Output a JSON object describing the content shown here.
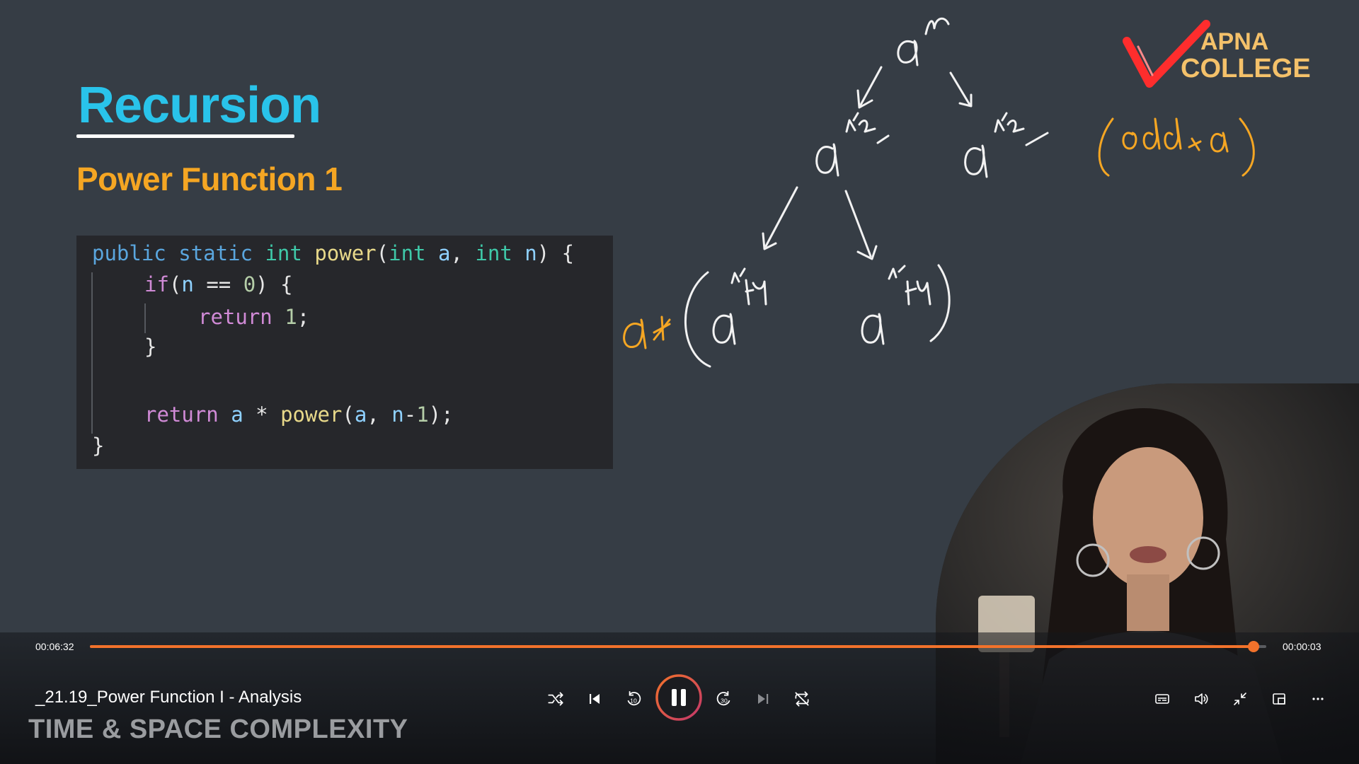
{
  "slide": {
    "title": "Recursion",
    "subtitle": "Power Function 1",
    "code": {
      "l1_public": "public",
      "l1_static": "static",
      "l1_int": "int",
      "l1_fn": "power",
      "l1_int2": "int",
      "l1_a": "a",
      "l1_int3": "int",
      "l1_n": "n",
      "l2_if": "if",
      "l2_n": "n",
      "l2_zero": "0",
      "l3_return": "return",
      "l3_one": "1",
      "l5_return": "return",
      "l5_a": "a",
      "l5_fn": "power",
      "l5_a2": "a",
      "l5_n": "n",
      "l5_one": "1"
    }
  },
  "logo": {
    "line1": "APNA",
    "line2": "COLLEGE"
  },
  "player": {
    "elapsed": "00:06:32",
    "remaining": "00:00:03",
    "progress": 0.989,
    "media_title": "_21.19_Power Function I - Analysis",
    "overlay_title": "TIME & SPACE COMPLEXITY",
    "accent_color": "#f2722b"
  },
  "icons": {
    "shuffle": "shuffle-icon",
    "previous": "previous-icon",
    "rewind": "rewind-10-icon",
    "pause": "pause-icon",
    "forward": "forward-30-icon",
    "next": "next-icon",
    "repeat": "repeat-icon",
    "captions": "captions-icon",
    "volume": "volume-icon",
    "exit_fullscreen": "exit-fullscreen-icon",
    "mini_player": "mini-player-icon",
    "more": "more-icon"
  }
}
